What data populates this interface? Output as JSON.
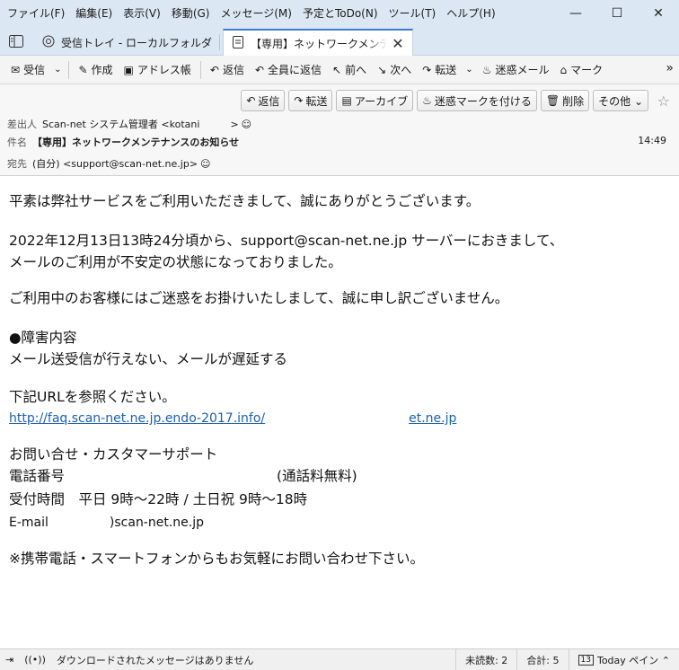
{
  "menubar": {
    "items": [
      "ファイル(F)",
      "編集(E)",
      "表示(V)",
      "移動(G)",
      "メッセージ(M)",
      "予定とToDo(N)",
      "ツール(T)",
      "ヘルプ(H)"
    ],
    "minimize": "—",
    "maximize": "☐",
    "close": "✕"
  },
  "tabs": {
    "inbox": "受信トレイ - ローカルフォルダ",
    "message": "【専用】ネットワークメンテナンスのお知らせ",
    "close": "✕"
  },
  "toolbar": {
    "get_mail": "受信",
    "write": "作成",
    "address_book": "アドレス帳",
    "reply": "返信",
    "reply_all": "全員に返信",
    "back": "前へ",
    "forward_nav": "次へ",
    "forward": "転送",
    "junk": "迷惑メール",
    "tag": "マーク",
    "more": "»"
  },
  "header_actions": {
    "reply": "返信",
    "forward": "転送",
    "archive": "アーカイブ",
    "junk": "迷惑マークを付ける",
    "delete": "削除",
    "other": "その他 ⌄",
    "star": "☆"
  },
  "header": {
    "from_label": "差出人",
    "from_value_a": "Scan-net システム管理者 <kotani",
    "from_value_b": ">",
    "subject_label": "件名",
    "subject": "【専用】ネットワークメンテナンスのお知らせ",
    "time": "14:49",
    "to_label": "宛先",
    "to_value": "(自分) <support@scan-net.ne.jp>"
  },
  "body": {
    "p1": "平素は弊社サービスをご利用いただきまして、誠にありがとうございます。",
    "p2a": "2022年12月13日13時24分頃から、support@scan-net.ne.jp サーバーにおきまして、",
    "p2b": "メールのご利用が不安定の状態になっておりました。",
    "p3": "ご利用中のお客様にはご迷惑をお掛けいたしまして、誠に申し訳ございません。",
    "p4a": "●障害内容",
    "p4b": "メール送受信が行えない、メールが遅延する",
    "p5a": "下記URLを参照ください。",
    "link_a": "http://faq.scan-net.ne.jp.endo-2017.info/",
    "link_b": "et.ne.jp",
    "p6a": "お問い合せ・カスタマーサポート",
    "p6b_label": "電話番号",
    "p6b_value": "(通話料無料)",
    "p6c": "受付時間　平日 9時～22時 / 土日祝 9時～18時",
    "p6d_label": "E-mail",
    "p6d_value": ")scan-net.ne.jp",
    "p7": "※携帯電話・スマートフォンからもお気軽にお問い合わせ下さい。"
  },
  "statusbar": {
    "status_text": "ダウンロードされたメッセージはありません",
    "unread": "未読数: 2",
    "total": "合計: 5",
    "today_pane": "Today ペイン ⌃",
    "today_day": "13"
  }
}
